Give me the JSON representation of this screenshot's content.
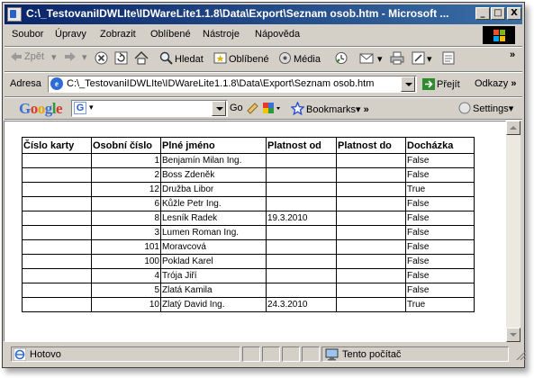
{
  "window": {
    "title": "C:\\_TestovaniIDWLIte\\IDWareLite1.1.8\\Data\\Export\\Seznam osob.htm - Microsoft ...",
    "controls": {
      "minimize": "_",
      "maximize": "□",
      "close": "X"
    }
  },
  "menu": [
    "Soubor",
    "Úpravy",
    "Zobrazit",
    "Oblíbené",
    "Nástroje",
    "Nápověda"
  ],
  "toolbar": {
    "back": "Zpět",
    "search": "Hledat",
    "favorites": "Oblíbené",
    "media": "Média"
  },
  "address": {
    "label": "Adresa",
    "value": "C:\\_TestovaniIDWLIte\\IDWareLite1.1.8\\Data\\Export\\Seznam osob.htm",
    "go": "Přejít",
    "links": "Odkazy"
  },
  "google_bar": {
    "logo": "Google",
    "go": "Go",
    "bookmarks": "Bookmarks",
    "settings": "Settings"
  },
  "table": {
    "headers": [
      "Číslo karty",
      "Osobní číslo",
      "Plné jméno",
      "Platnost od",
      "Platnost do",
      "Docházka"
    ],
    "rows": [
      [
        "",
        "1",
        "Benjamín Milan Ing.",
        "",
        "",
        "False"
      ],
      [
        "",
        "2",
        "Boss Zdeněk",
        "",
        "",
        "False"
      ],
      [
        "",
        "12",
        "Družba Libor",
        "",
        "",
        "True"
      ],
      [
        "",
        "6",
        "Kůžle Petr Ing.",
        "",
        "",
        "False"
      ],
      [
        "",
        "8",
        "Lesník Radek",
        "19.3.2010",
        "",
        "False"
      ],
      [
        "",
        "3",
        "Lumen Roman Ing.",
        "",
        "",
        "False"
      ],
      [
        "",
        "101",
        "Moravcová",
        "",
        "",
        "False"
      ],
      [
        "",
        "100",
        "Poklad Karel",
        "",
        "",
        "False"
      ],
      [
        "",
        "4",
        "Trója Jiří",
        "",
        "",
        "False"
      ],
      [
        "",
        "5",
        "Zlatá Kamila",
        "",
        "",
        "False"
      ],
      [
        "",
        "10",
        "Zlatý David Ing.",
        "24.3.2010",
        "",
        "True"
      ]
    ]
  },
  "status": {
    "left": "Hotovo",
    "zone": "Tento počítač"
  }
}
